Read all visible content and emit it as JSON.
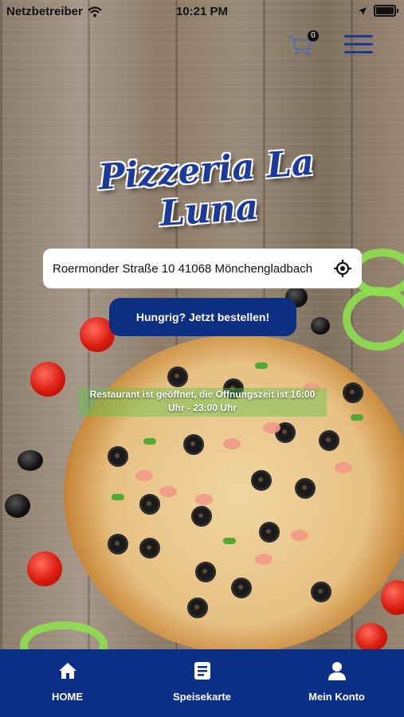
{
  "status_bar": {
    "carrier": "Netzbetreiber",
    "time": "10:21 PM"
  },
  "header": {
    "cart_count": "0",
    "cart_icon": "cart-icon",
    "menu_icon": "hamburger-menu-icon"
  },
  "logo": {
    "text": "Pizzeria La Luna"
  },
  "address": {
    "value": "Roermonder Straße 10 41068 Mönchengladbach",
    "icon": "locate-icon"
  },
  "order_button": {
    "label": "Hungrig? Jetzt bestellen!"
  },
  "open_status": {
    "line1": "Restaurant ist geöffnet, die Öffnungszeit ist 16:00",
    "line2": "Uhr - 23:00 Uhr"
  },
  "tabbar": {
    "items": [
      {
        "label": "HOME",
        "icon": "home-icon"
      },
      {
        "label": "Speisekarte",
        "icon": "menu-card-icon"
      },
      {
        "label": "Mein Konto",
        "icon": "user-icon"
      }
    ]
  },
  "colors": {
    "brand_blue": "#0b2e88",
    "open_green": "#5fc346"
  }
}
